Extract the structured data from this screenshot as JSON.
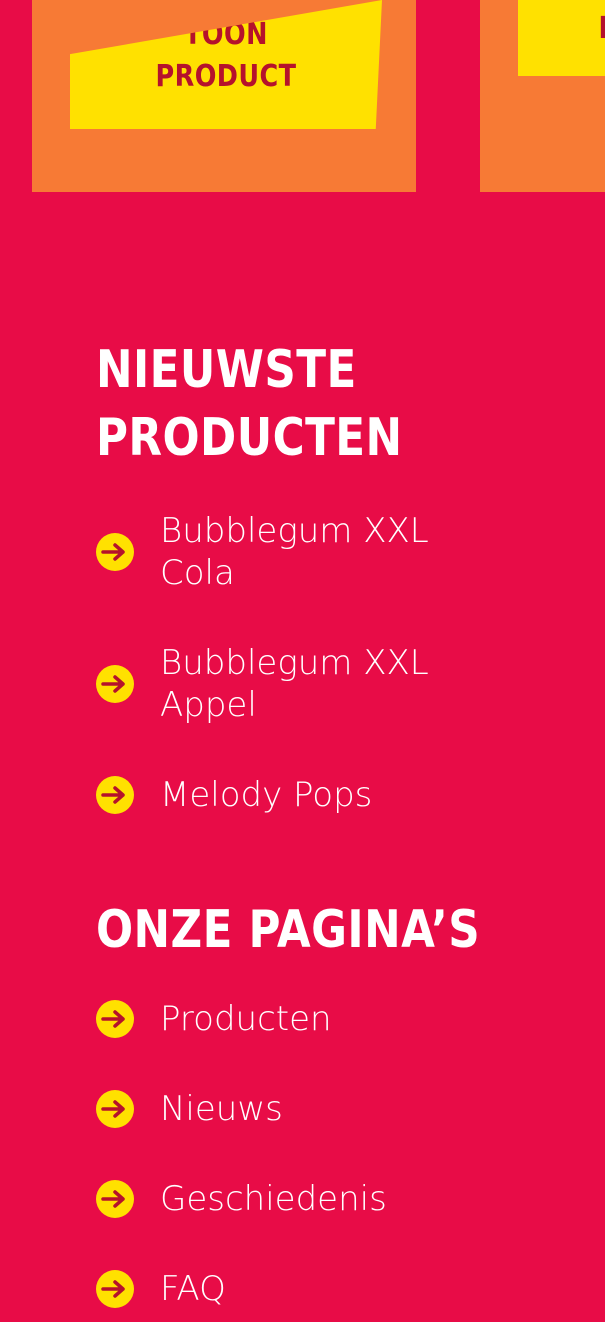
{
  "product_card": {
    "button_line1": "TOON",
    "button_line2": "PRODUCT"
  },
  "product_card_partial": {
    "button_fragment": "I"
  },
  "newest_products": {
    "title_line1": "NIEUWSTE",
    "title_line2": "PRODUCTEN",
    "items": [
      {
        "label": "Bubblegum XXL Cola",
        "icon": "arrow-right-icon"
      },
      {
        "label": "Bubblegum XXL Appel",
        "icon": "arrow-right-icon"
      },
      {
        "label": "Melody Pops",
        "icon": "arrow-right-icon"
      }
    ]
  },
  "our_pages": {
    "title": "ONZE PAGINA’S",
    "items": [
      {
        "label": "Producten",
        "icon": "arrow-right-icon"
      },
      {
        "label": "Nieuws",
        "icon": "arrow-right-icon"
      },
      {
        "label": "Geschiedenis",
        "icon": "arrow-right-icon"
      },
      {
        "label": "FAQ",
        "icon": "arrow-right-icon"
      }
    ]
  },
  "colors": {
    "background": "#e80c47",
    "card": "#f77a35",
    "accent_yellow": "#ffe100",
    "button_text": "#b5122c",
    "text": "#ffffff"
  }
}
